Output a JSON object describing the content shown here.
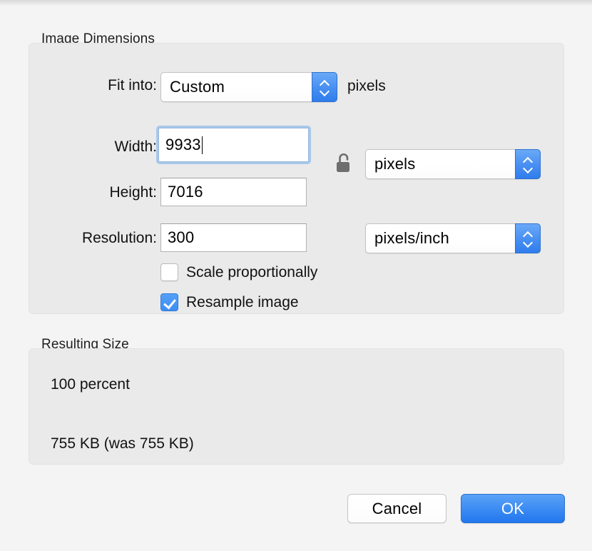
{
  "dialog": {
    "sections": {
      "dimensions": {
        "title": "Image Dimensions",
        "fit_into": {
          "label": "Fit into:",
          "value": "Custom",
          "unit_suffix": "pixels"
        },
        "width": {
          "label": "Width:",
          "value": "9933"
        },
        "height": {
          "label": "Height:",
          "value": "7016"
        },
        "resolution": {
          "label": "Resolution:",
          "value": "300"
        },
        "size_unit": {
          "value": "pixels"
        },
        "resolution_unit": {
          "value": "pixels/inch"
        },
        "lock": {
          "state": "unlocked"
        },
        "scale_proportionally": {
          "label": "Scale proportionally",
          "checked": false
        },
        "resample_image": {
          "label": "Resample image",
          "checked": true
        }
      },
      "resulting_size": {
        "title": "Resulting Size",
        "percent_line": "100 percent",
        "size_line": "755 KB (was 755 KB)"
      }
    },
    "buttons": {
      "cancel": "Cancel",
      "ok": "OK"
    }
  },
  "colors": {
    "accent_blue": "#3e8df3",
    "focus_ring": "#a8c8ea",
    "group_fill": "#eaeaea",
    "page_background": "#f4f4f4",
    "lock_gray": "#6e6e6e"
  }
}
